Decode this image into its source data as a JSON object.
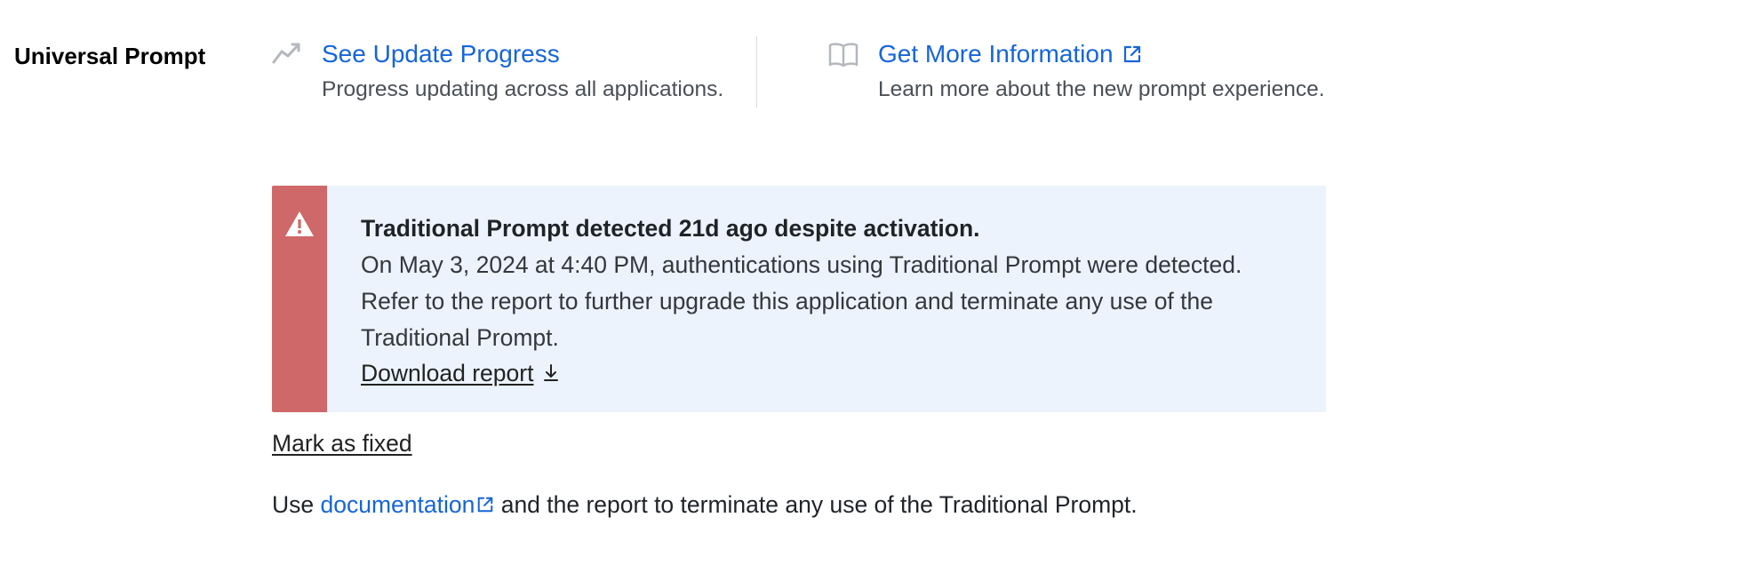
{
  "section_label": "Universal Prompt",
  "actions": {
    "progress": {
      "link": "See Update Progress",
      "sub": "Progress updating across all applications."
    },
    "info": {
      "link": "Get More Information",
      "sub": "Learn more about the new prompt experience."
    }
  },
  "alert": {
    "title": "Traditional Prompt detected 21d ago despite activation.",
    "body": "On May 3, 2024 at 4:40 PM, authentications using Traditional Prompt were detected. Refer to the report to further upgrade this application and terminate any use of the Traditional Prompt.",
    "download": "Download report "
  },
  "mark_fixed": "Mark as fixed",
  "footer": {
    "prefix": "Use ",
    "doc_link": "documentation",
    "suffix": " and the report to terminate any use of the Traditional Prompt."
  }
}
